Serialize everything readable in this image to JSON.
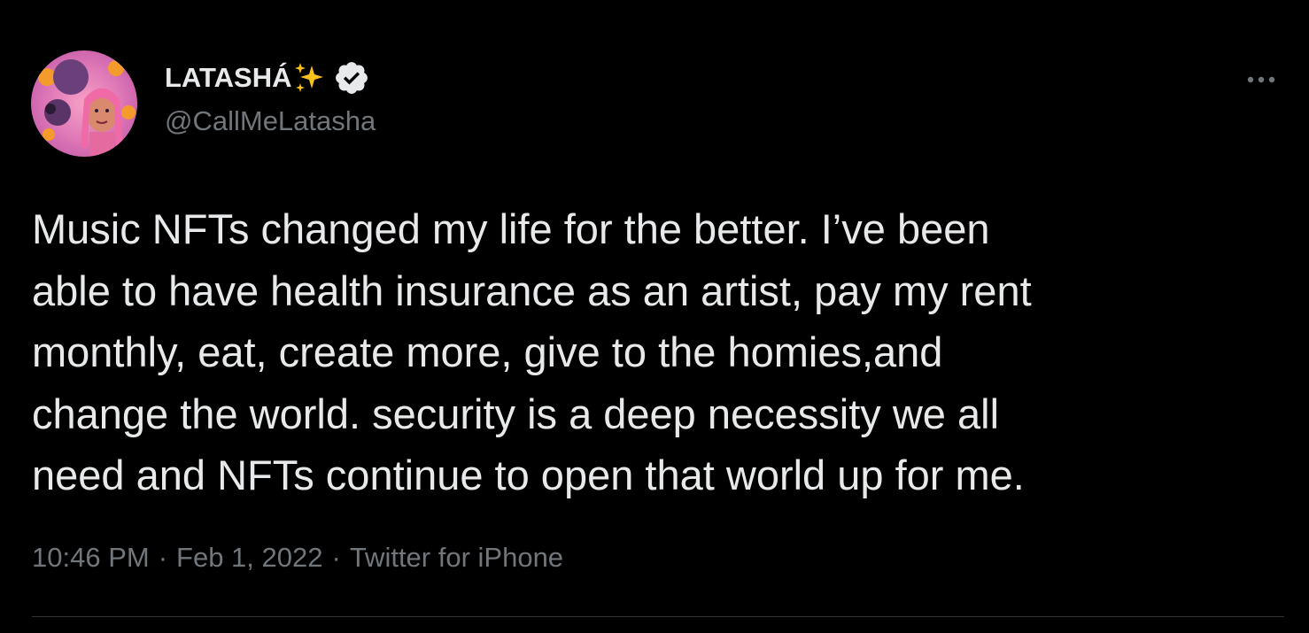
{
  "author": {
    "display_name": "LATASHÁ",
    "handle": "@CallMeLatasha",
    "name_emoji": "sparkles-icon",
    "verified_badge": "verified-icon"
  },
  "tweet": {
    "text": "Music NFTs changed my life for the better. I’ve been\nable to have health insurance as an artist, pay my rent\nmonthly, eat, create more, give to the homies,and\nchange the world. security is a deep necessity we all\nneed and NFTs continue to open that world up for me.",
    "time": "10:46 PM",
    "date": "Feb 1, 2022",
    "source": "Twitter for iPhone",
    "separator": "·"
  },
  "colors": {
    "background": "#000000",
    "primary_text": "#e7e9ea",
    "secondary_text": "#71767b",
    "divider": "#2f3336",
    "sparkles": "#fcc21b"
  }
}
